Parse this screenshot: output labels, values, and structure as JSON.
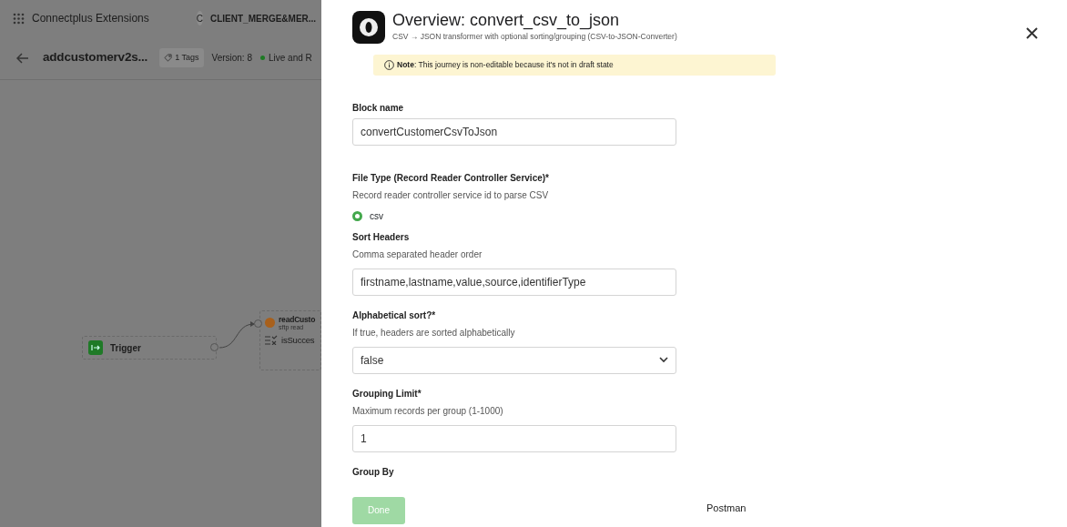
{
  "app_header": {
    "title": "Connectplus Extensions",
    "workspace": {
      "initial": "C",
      "name": "CLIENT_MERGE&MER..."
    }
  },
  "journey_bar": {
    "name": "addcustomerv2s...",
    "tags": "1 Tags",
    "version": "Version: 8",
    "status": "Live and R"
  },
  "canvas": {
    "nodes": [
      {
        "kind": "trigger",
        "title": "Trigger"
      },
      {
        "kind": "step",
        "title": "readCusto",
        "subtitle": "sftp read",
        "condition": "isSucces"
      }
    ]
  },
  "drawer": {
    "title": "Overview: convert_csv_to_json",
    "subtitle": "CSV → JSON transformer with optional sorting/grouping (CSV-to-JSON-Converter)",
    "note": "**Note**: This journey is non-editable because it's not in draft state",
    "fields": [
      {
        "kind": "text",
        "label": "Block name",
        "value": "convertCustomerCsvToJson"
      },
      {
        "kind": "radio",
        "label": "File Type (Record Reader Controller Service)*",
        "help": "Record reader controller service id to parse CSV",
        "options": [
          {
            "label": "csv",
            "selected": true
          }
        ]
      },
      {
        "kind": "text",
        "label": "Sort Headers",
        "help": "Comma separated header order",
        "value": "firstname,lastname,value,source,identifierType"
      },
      {
        "kind": "select",
        "label": "Alphabetical sort?*",
        "help": "If true, headers are sorted alphabetically",
        "value": "false"
      },
      {
        "kind": "text",
        "label": "Grouping Limit*",
        "help": "Maximum records per group (1-1000)",
        "value": "1"
      },
      {
        "kind": "heading",
        "label": "Group By"
      }
    ],
    "done_button": {
      "label": "Done",
      "disabled": true
    }
  },
  "tooltip": "Postman"
}
